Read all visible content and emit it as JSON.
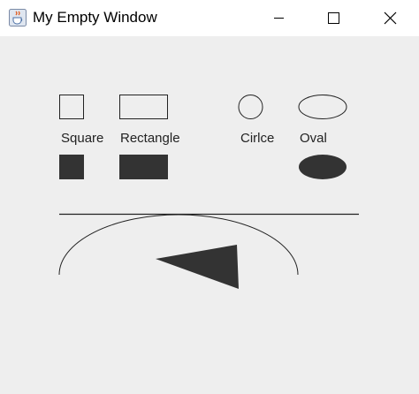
{
  "window": {
    "title": "My Empty Window",
    "app_icon": "java-cup-icon",
    "buttons": {
      "minimize_icon": "minimize-icon",
      "maximize_icon": "maximize-icon",
      "close_icon": "close-icon"
    }
  },
  "canvas": {
    "background": "#eeeeee",
    "stroke_color": "#222222",
    "fill_color": "#333333",
    "labels": {
      "square": "Square",
      "rectangle": "Rectangle",
      "circle": "Cirlce",
      "oval": "Oval"
    }
  }
}
